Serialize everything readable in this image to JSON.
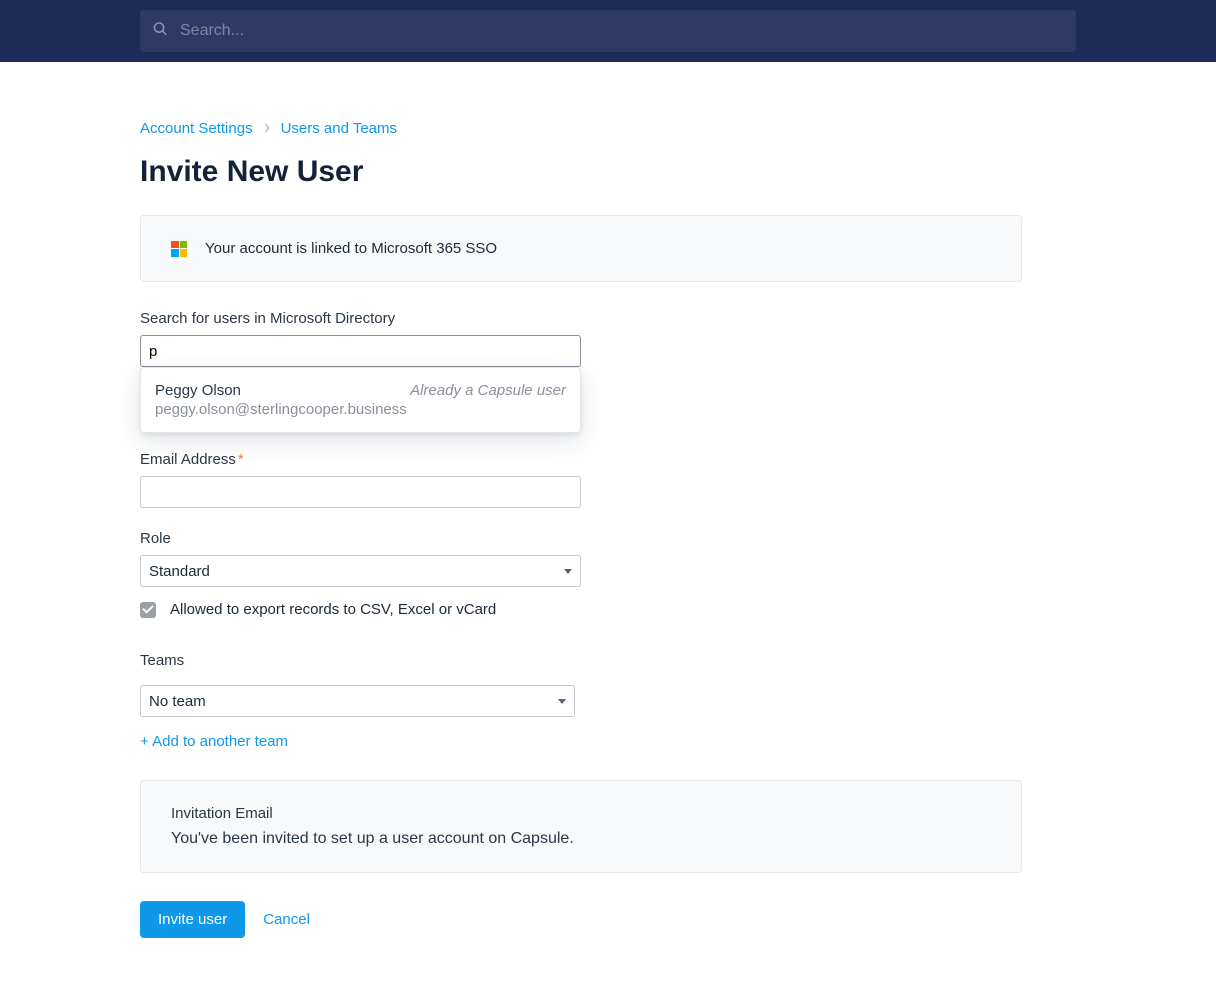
{
  "header": {
    "search_placeholder": "Search..."
  },
  "breadcrumb": {
    "item1": "Account Settings",
    "item2": "Users and Teams"
  },
  "page": {
    "title": "Invite New User"
  },
  "sso_panel": {
    "message": "Your account is linked to Microsoft 365 SSO"
  },
  "form": {
    "directory_label": "Search for users in Microsoft Directory",
    "directory_value": "p",
    "autocomplete": {
      "name": "Peggy Olson",
      "note": "Already a Capsule user",
      "email": "peggy.olson@sterlingcooper.business"
    },
    "email_label": "Email Address",
    "email_value": "",
    "role_label": "Role",
    "role_value": "Standard",
    "export_label": "Allowed to export records to CSV, Excel or vCard",
    "export_checked": true
  },
  "teams": {
    "label": "Teams",
    "selected": "No team",
    "add_link": "+ Add to another team"
  },
  "invitation": {
    "heading": "Invitation Email",
    "body": "You've been invited to set up a user account on Capsule."
  },
  "actions": {
    "invite": "Invite user",
    "cancel": "Cancel"
  }
}
